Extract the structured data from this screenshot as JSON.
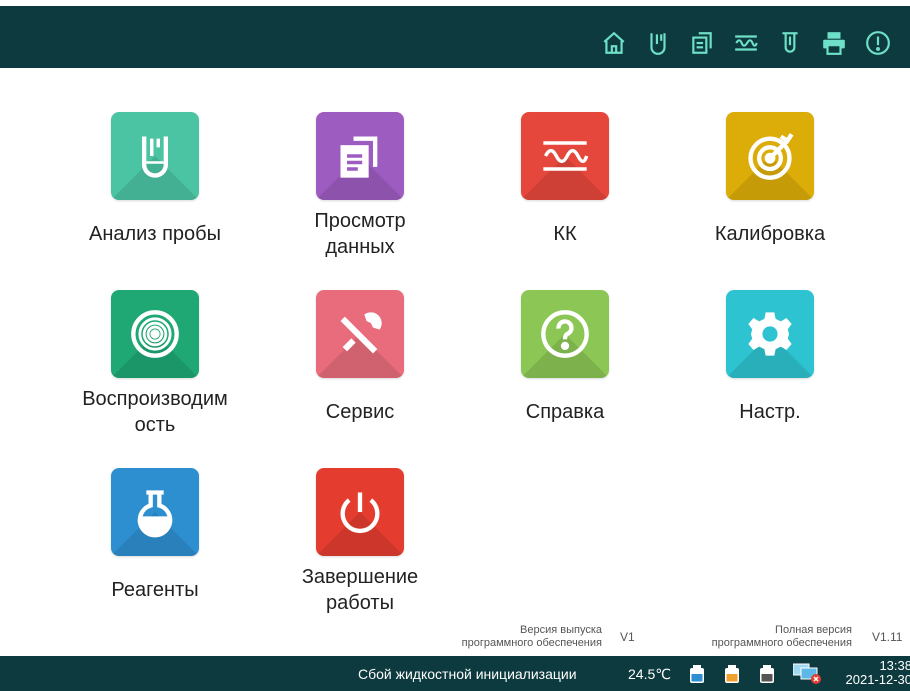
{
  "toolbar": {
    "icons": [
      "home-icon",
      "sample-tube-icon",
      "data-review-icon",
      "qc-wave-icon",
      "tube-icon",
      "printer-icon",
      "info-icon"
    ],
    "color": "#6fe0c8"
  },
  "tiles": [
    {
      "label": "Анализ пробы",
      "icon": "sample-tube-icon",
      "color": "#4bc4a4"
    },
    {
      "label": "Просмотр\nданных",
      "icon": "data-review-icon",
      "color": "#9c5cc0"
    },
    {
      "label": "КК",
      "icon": "qc-wave-icon",
      "color": "#e6473d"
    },
    {
      "label": "Калибровка",
      "icon": "target-icon",
      "color": "#dcad08"
    },
    {
      "label": "Воспроизводим\nость",
      "icon": "reproducibility-icon",
      "color": "#1fa874"
    },
    {
      "label": "Сервис",
      "icon": "tools-icon",
      "color": "#e86c7c"
    },
    {
      "label": "Справка",
      "icon": "help-icon",
      "color": "#8cc654"
    },
    {
      "label": "Настр.",
      "icon": "gear-icon",
      "color": "#2ec3d0"
    },
    {
      "label": "Реагенты",
      "icon": "flask-icon",
      "color": "#2e8fd0"
    },
    {
      "label": "Завершение\nработы",
      "icon": "power-icon",
      "color": "#e43d30"
    }
  ],
  "version": {
    "release_label": "Версия выпуска\nпрограммного обеспечения",
    "release_value": "V1",
    "full_label": "Полная версия\nпрограммного обеспечения",
    "full_value": "V1.11"
  },
  "status": {
    "message": "Сбой жидкостной инициализации",
    "temperature": "24.5℃",
    "time": "13:38",
    "date": "2021-12-30"
  }
}
